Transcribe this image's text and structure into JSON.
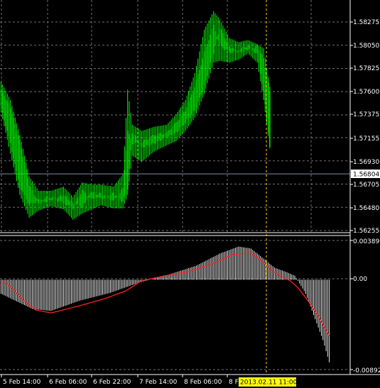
{
  "colors": {
    "background": "#000000",
    "grid": "#707070",
    "candle_up": "#00ff00",
    "candle_down": "#00ff00",
    "histogram": "#e6e6e6",
    "signal_line": "#ff2020",
    "crosshair_v": "#ffd700",
    "current_price_line": "#7a8fa6",
    "time_label_bg": "#ffff00",
    "price_label_bg": "#ffffff"
  },
  "price_axis": {
    "ticks": [
      "1.58275",
      "1.58050",
      "1.57825",
      "1.57600",
      "1.57375",
      "1.57155",
      "1.56930",
      "1.56705",
      "1.56480",
      "1.56255"
    ],
    "current_price": "1.56804"
  },
  "osc_axis": {
    "top": "0.003899",
    "zero": "0.00",
    "bottom": "-0.008924"
  },
  "time_axis": {
    "labels": [
      "5 Feb 14:00",
      "6 Feb 06:00",
      "6 Feb 22:00",
      "7 Feb 14:00",
      "8 Feb 06:00"
    ],
    "truncated_label": "8 F",
    "highlight": "2013.02.11 11:00"
  },
  "chart_data": [
    {
      "type": "candlestick",
      "ylim": [
        1.56255,
        1.58275
      ],
      "yticks": [
        1.58275,
        1.5805,
        1.57825,
        1.576,
        1.57375,
        1.57155,
        1.5693,
        1.56705,
        1.5648,
        1.56255
      ],
      "current_price": 1.56804,
      "anchors": [
        [
          0,
          1.5762,
          1.5745,
          1.577,
          1.574
        ],
        [
          6,
          1.5745,
          1.571,
          1.5752,
          1.57
        ],
        [
          12,
          1.5712,
          1.5668,
          1.5718,
          1.566
        ],
        [
          18,
          1.567,
          1.565,
          1.5678,
          1.5638
        ],
        [
          24,
          1.5652,
          1.5655,
          1.5664,
          1.5645
        ],
        [
          32,
          1.5655,
          1.5658,
          1.5664,
          1.5649
        ],
        [
          40,
          1.566,
          1.5652,
          1.5668,
          1.5646
        ],
        [
          46,
          1.5652,
          1.5647,
          1.5658,
          1.5636
        ],
        [
          52,
          1.5648,
          1.5665,
          1.5672,
          1.5642
        ],
        [
          58,
          1.5664,
          1.5655,
          1.567,
          1.5646
        ],
        [
          64,
          1.5656,
          1.5662,
          1.567,
          1.565
        ],
        [
          72,
          1.5662,
          1.5654,
          1.5668,
          1.5647
        ],
        [
          78,
          1.5653,
          1.5666,
          1.568,
          1.5647
        ],
        [
          81,
          1.5666,
          1.5722,
          1.5762,
          1.566
        ],
        [
          84,
          1.5721,
          1.571,
          1.5728,
          1.5698
        ],
        [
          90,
          1.5706,
          1.5711,
          1.5722,
          1.5692
        ],
        [
          98,
          1.571,
          1.5718,
          1.5726,
          1.5702
        ],
        [
          106,
          1.5716,
          1.572,
          1.5728,
          1.5708
        ],
        [
          112,
          1.572,
          1.573,
          1.5738,
          1.5712
        ],
        [
          118,
          1.573,
          1.5742,
          1.5752,
          1.5722
        ],
        [
          124,
          1.5742,
          1.5765,
          1.5778,
          1.5735
        ],
        [
          130,
          1.5765,
          1.5798,
          1.582,
          1.5758
        ],
        [
          136,
          1.5798,
          1.5824,
          1.5838,
          1.5788
        ],
        [
          140,
          1.5822,
          1.5805,
          1.583,
          1.579
        ],
        [
          146,
          1.5804,
          1.5798,
          1.5812,
          1.5788
        ],
        [
          152,
          1.5798,
          1.58,
          1.5808,
          1.5791
        ],
        [
          158,
          1.5801,
          1.5805,
          1.581,
          1.5797
        ],
        [
          164,
          1.5804,
          1.5796,
          1.5806,
          1.5788
        ],
        [
          168,
          1.5792,
          1.576,
          1.5802,
          1.5752
        ],
        [
          172,
          1.576,
          1.5708,
          1.5765,
          1.5705
        ]
      ]
    },
    {
      "type": "bar",
      "title": "",
      "ylim": [
        -0.008924,
        0.003899
      ],
      "histogram_anchors": [
        [
          0,
          -0.0014
        ],
        [
          20,
          -0.0029
        ],
        [
          32,
          -0.0031
        ],
        [
          50,
          -0.0021
        ],
        [
          70,
          -0.0013
        ],
        [
          88,
          -0.0003
        ],
        [
          105,
          0.0004
        ],
        [
          125,
          0.0014
        ],
        [
          140,
          0.0026
        ],
        [
          152,
          0.0033
        ],
        [
          160,
          0.0031
        ],
        [
          168,
          0.0021
        ],
        [
          175,
          0.0012
        ],
        [
          182,
          0.0008
        ],
        [
          188,
          0.0004
        ],
        [
          195,
          -0.0014
        ],
        [
          200,
          -0.0035
        ],
        [
          206,
          -0.006
        ],
        [
          210,
          -0.0082
        ]
      ],
      "signal_anchors": [
        [
          0,
          -0.0003
        ],
        [
          4,
          -0.0004
        ],
        [
          8,
          -0.001
        ],
        [
          14,
          -0.002
        ],
        [
          22,
          -0.003
        ],
        [
          32,
          -0.0033
        ],
        [
          50,
          -0.0026
        ],
        [
          66,
          -0.0019
        ],
        [
          80,
          -0.0011
        ],
        [
          90,
          -0.0001
        ],
        [
          105,
          0.0004
        ],
        [
          120,
          0.0008
        ],
        [
          130,
          0.0013
        ],
        [
          140,
          0.0019
        ],
        [
          148,
          0.0025
        ],
        [
          155,
          0.0026
        ],
        [
          160,
          0.0026
        ],
        [
          166,
          0.002
        ],
        [
          172,
          0.0011
        ],
        [
          178,
          0.0004
        ],
        [
          185,
          -0.0001
        ],
        [
          190,
          -0.0008
        ],
        [
          196,
          -0.002
        ],
        [
          203,
          -0.0036
        ],
        [
          210,
          -0.0056
        ]
      ]
    }
  ]
}
